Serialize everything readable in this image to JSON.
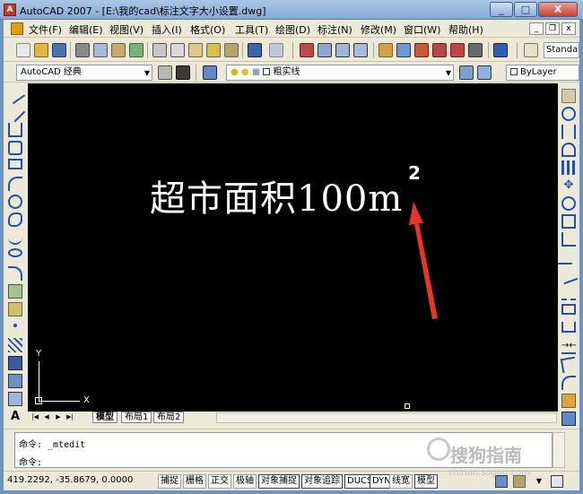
{
  "window": {
    "title": "AutoCAD 2007 - [E:\\我的cad\\标注文字大小设置.dwg]",
    "app_icon": "A",
    "min_label": "_",
    "max_label": "□",
    "close_label": "X"
  },
  "menu": {
    "items": [
      "文件(F)",
      "编辑(E)",
      "视图(V)",
      "插入(I)",
      "格式(O)",
      "工具(T)",
      "绘图(D)",
      "标注(N)",
      "修改(M)",
      "窗口(W)",
      "帮助(H)"
    ],
    "mdi_min": "_",
    "mdi_restore": "❐",
    "mdi_close": "x"
  },
  "toolbar": {
    "text_style": "Standar"
  },
  "workspace": {
    "name": "AutoCAD 经典"
  },
  "layer": {
    "name": "粗实线"
  },
  "properties": {
    "color": "ByLayer"
  },
  "canvas": {
    "text": "超市面积100m",
    "superscript": "2",
    "ucs_y": "Y",
    "ucs_x": "X"
  },
  "layout_tabs": [
    "模型",
    "布局1",
    "布局2"
  ],
  "command": {
    "history": "命令:  _mtedit",
    "prompt": "命令:"
  },
  "status": {
    "coordinates": "419.2292,  -35.8679,  0.0000",
    "buttons": [
      "捕捉",
      "栅格",
      "正交",
      "极轴",
      "对象捕捉",
      "对象追踪",
      "DUCS",
      "DYN",
      "线宽",
      "模型"
    ]
  },
  "watermark": {
    "text": "搜狗指南",
    "sub": "zhinan.sogou.com"
  },
  "colors": {
    "canvas_bg": "#000000",
    "arrow": "#e8352b",
    "chrome": "#ece9d8"
  }
}
